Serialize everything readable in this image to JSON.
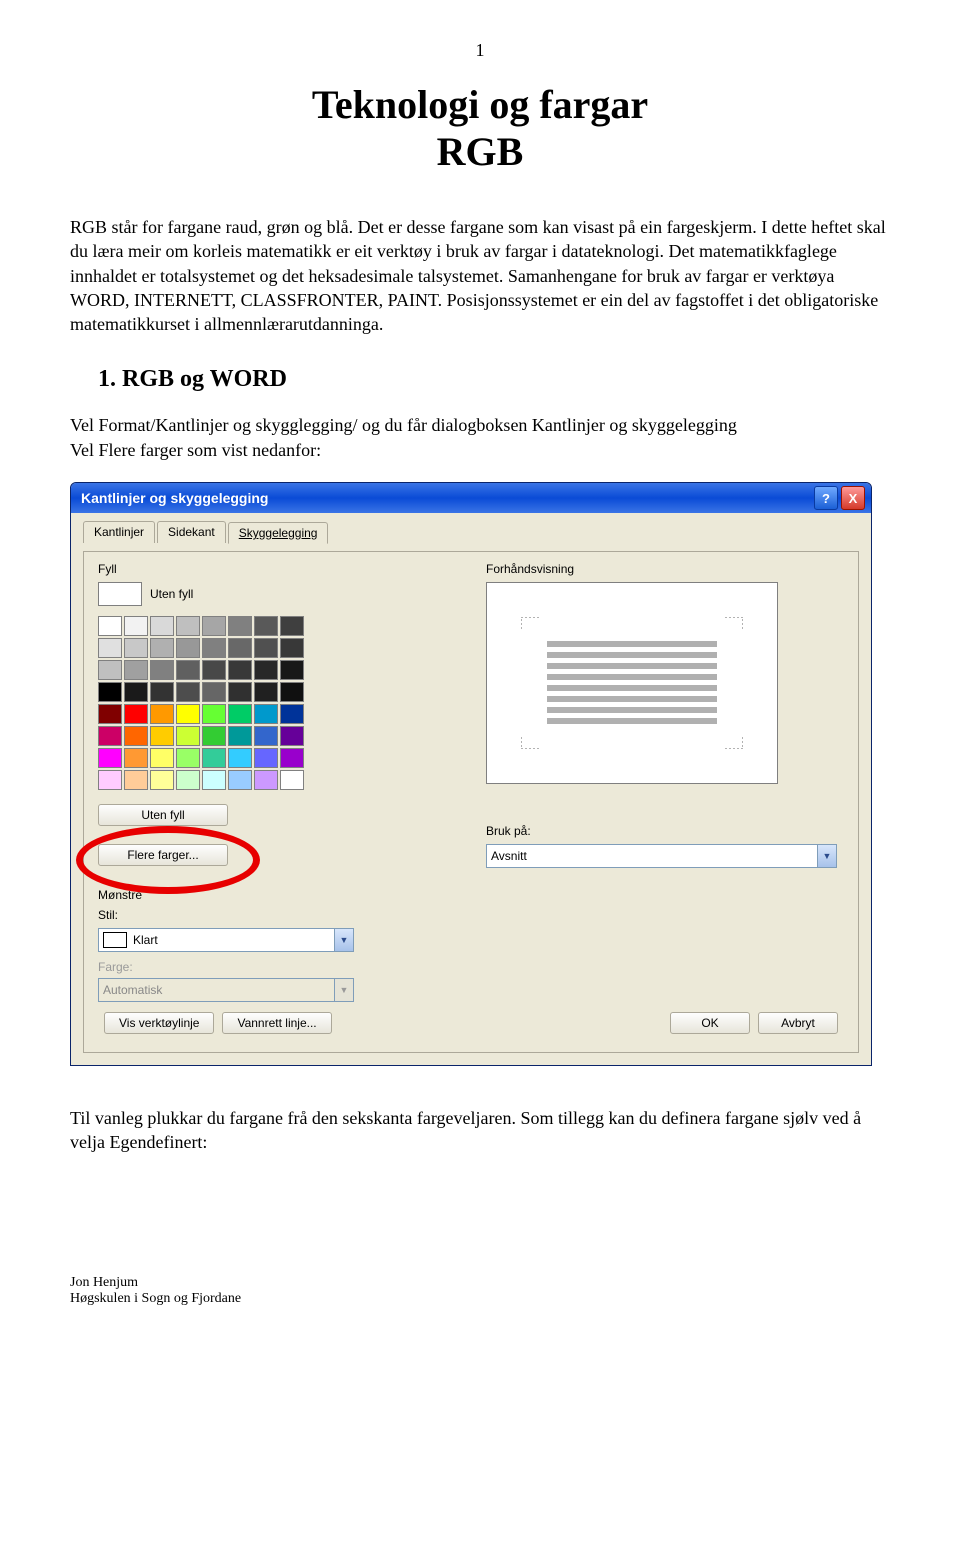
{
  "page_number": "1",
  "title_line1": "Teknologi og fargar",
  "title_line2": "RGB",
  "intro_paragraph": "RGB står for fargane raud, grøn og blå. Det er desse fargane som kan visast på ein fargeskjerm. I dette heftet skal du læra meir om korleis matematikk er eit verktøy i bruk av fargar i datateknologi. Det matematikkfaglege innhaldet er totalsystemet og det heksadesimale talsystemet. Samanhengane for bruk av fargar er verktøya WORD, INTERNETT, CLASSFRONTER, PAINT. Posisjonssystemet er ein del av fagstoffet i det obligatoriske matematikkurset i allmennlærarutdanninga.",
  "section1_heading": "1. RGB og WORD",
  "section1_line1": "Vel Format/Kantlinjer og skygglegging/ og du får dialogboksen Kantlinjer og skyggelegging",
  "section1_line2": "Vel Flere farger som vist nedanfor:",
  "dialog": {
    "title": "Kantlinjer og skyggelegging",
    "help": "?",
    "close": "X",
    "tabs": [
      "Kantlinjer",
      "Sidekant",
      "Skyggelegging"
    ],
    "fyll_label": "Fyll",
    "uten_fyll": "Uten fyll",
    "flere_farger": "Flere farger...",
    "forhand_label": "Forhåndsvisning",
    "monstre_label": "Mønstre",
    "stil_label": "Stil:",
    "stil_value": "Klart",
    "farge_label": "Farge:",
    "farge_value": "Automatisk",
    "brukpa_label": "Bruk på:",
    "brukpa_value": "Avsnitt",
    "vis_verktoylinje": "Vis verktøylinje",
    "vannrett_linje": "Vannrett linje...",
    "ok": "OK",
    "avbryt": "Avbryt"
  },
  "palette_colors": [
    [
      "#ffffff",
      "#f2f2f2",
      "#d9d9d9",
      "#bfbfbf",
      "#a6a6a6",
      "#808080",
      "#595959",
      "#3f3f3f"
    ],
    [
      "#e0e0e0",
      "#c8c8c8",
      "#b0b0b0",
      "#989898",
      "#808080",
      "#686868",
      "#505050",
      "#383838"
    ],
    [
      "#c0c0c0",
      "#a0a0a0",
      "#808080",
      "#606060",
      "#484848",
      "#383838",
      "#282828",
      "#181818"
    ],
    [
      "#000000",
      "#1a1a1a",
      "#333333",
      "#4d4d4d",
      "#666666",
      "#303030",
      "#202020",
      "#101010"
    ],
    [
      "#800000",
      "#ff0000",
      "#ff9900",
      "#ffff00",
      "#66ff33",
      "#00cc66",
      "#0099cc",
      "#003399"
    ],
    [
      "#cc0066",
      "#ff6600",
      "#ffcc00",
      "#ccff33",
      "#33cc33",
      "#009999",
      "#3366cc",
      "#660099"
    ],
    [
      "#ff00ff",
      "#ff9933",
      "#ffff66",
      "#99ff66",
      "#33cc99",
      "#33ccff",
      "#6666ff",
      "#9900cc"
    ],
    [
      "#ffccff",
      "#ffcc99",
      "#ffff99",
      "#ccffcc",
      "#ccffff",
      "#99ccff",
      "#cc99ff",
      "#ffffff"
    ]
  ],
  "closing_paragraph": "Til vanleg plukkar du fargane frå den sekskanta fargeveljaren. Som tillegg kan du definera fargane sjølv ved å velja Egendefinert:",
  "footer_line1": "Jon Henjum",
  "footer_line2": "Høgskulen i Sogn og Fjordane"
}
